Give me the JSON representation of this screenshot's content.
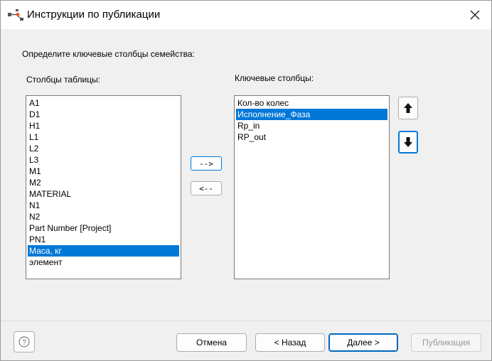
{
  "window": {
    "title": "Инструкции по публикации"
  },
  "instruction": "Определите ключевые столбцы семейства:",
  "table_columns": {
    "label": "Столбцы таблицы:",
    "items": [
      {
        "text": "A1"
      },
      {
        "text": "D1"
      },
      {
        "text": "H1"
      },
      {
        "text": "L1"
      },
      {
        "text": "L2"
      },
      {
        "text": "L3"
      },
      {
        "text": "M1"
      },
      {
        "text": "M2"
      },
      {
        "text": "MATERIAL"
      },
      {
        "text": "N1"
      },
      {
        "text": "N2"
      },
      {
        "text": "Part Number [Project]"
      },
      {
        "text": "PN1"
      },
      {
        "text": "Масa, кг"
      },
      {
        "text": "элемент"
      }
    ],
    "selected_index": 13
  },
  "key_columns": {
    "label": "Ключевые столбцы:",
    "items": [
      {
        "text": "Кол-во колес"
      },
      {
        "text": "Исполнение_Фаза"
      },
      {
        "text": "Rp_in"
      },
      {
        "text": "RP_out"
      }
    ],
    "selected_index": 1
  },
  "buttons": {
    "add": "-->",
    "remove": "<--",
    "cancel": "Отмена",
    "back": "< Назад",
    "next": "Далее >",
    "publish": "Публикация",
    "help": "?"
  },
  "icons": {
    "app": "publish-flow-icon",
    "close": "close-icon",
    "up": "arrow-up-icon",
    "down": "arrow-down-icon",
    "help": "help-icon"
  },
  "colors": {
    "selection": "#0078d7",
    "accent_border": "#0067c0"
  }
}
